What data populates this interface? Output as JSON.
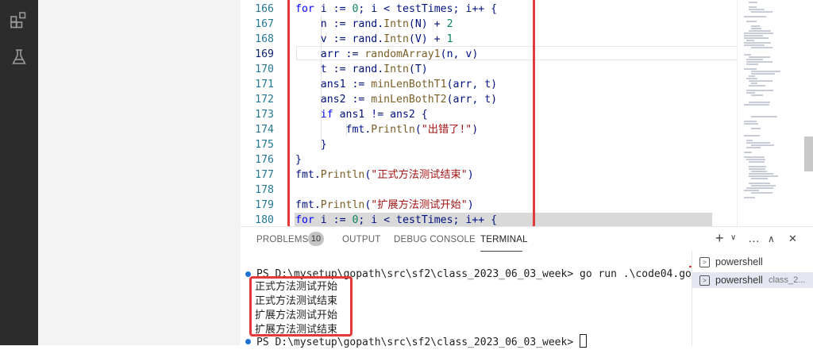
{
  "colors": {
    "accent_red": "#e23a3a",
    "activity_bar": "#2c2c2c",
    "keyword": "#0000ff",
    "number": "#098658",
    "string": "#a31515"
  },
  "activity_bar": {
    "icons": [
      "extensions-icon",
      "testing-flask-icon"
    ]
  },
  "editor": {
    "lines": [
      {
        "num": "166",
        "tokens": [
          {
            "t": "for",
            "c": "kw"
          },
          {
            "t": " i := ",
            "c": "var"
          },
          {
            "t": "0",
            "c": "num"
          },
          {
            "t": "; i < testTimes; i++ {",
            "c": "var"
          }
        ]
      },
      {
        "num": "167",
        "tokens": [
          {
            "t": "    n := rand.",
            "c": "var"
          },
          {
            "t": "Intn",
            "c": "fn"
          },
          {
            "t": "(N) + ",
            "c": "var"
          },
          {
            "t": "2",
            "c": "num"
          }
        ]
      },
      {
        "num": "168",
        "tokens": [
          {
            "t": "    v := rand.",
            "c": "var"
          },
          {
            "t": "Intn",
            "c": "fn"
          },
          {
            "t": "(V) + ",
            "c": "var"
          },
          {
            "t": "1",
            "c": "num"
          }
        ]
      },
      {
        "num": "169",
        "tokens": [
          {
            "t": "    arr := ",
            "c": "var"
          },
          {
            "t": "randomArray1",
            "c": "fn"
          },
          {
            "t": "(n, v)",
            "c": "var"
          }
        ]
      },
      {
        "num": "170",
        "tokens": [
          {
            "t": "    t := rand.",
            "c": "var"
          },
          {
            "t": "Intn",
            "c": "fn"
          },
          {
            "t": "(T)",
            "c": "var"
          }
        ]
      },
      {
        "num": "171",
        "tokens": [
          {
            "t": "    ans1 := ",
            "c": "var"
          },
          {
            "t": "minLenBothT1",
            "c": "fn"
          },
          {
            "t": "(arr, t)",
            "c": "var"
          }
        ]
      },
      {
        "num": "172",
        "tokens": [
          {
            "t": "    ans2 := ",
            "c": "var"
          },
          {
            "t": "minLenBothT2",
            "c": "fn"
          },
          {
            "t": "(arr, t)",
            "c": "var"
          }
        ]
      },
      {
        "num": "173",
        "tokens": [
          {
            "t": "    ",
            "c": "var"
          },
          {
            "t": "if",
            "c": "kw"
          },
          {
            "t": " ans1 != ans2 {",
            "c": "var"
          }
        ]
      },
      {
        "num": "174",
        "tokens": [
          {
            "t": "        fmt.",
            "c": "var"
          },
          {
            "t": "Println",
            "c": "fn"
          },
          {
            "t": "(",
            "c": "var"
          },
          {
            "t": "\"出错了!\"",
            "c": "str"
          },
          {
            "t": ")",
            "c": "var"
          }
        ]
      },
      {
        "num": "175",
        "tokens": [
          {
            "t": "    }",
            "c": "var"
          }
        ]
      },
      {
        "num": "176",
        "tokens": [
          {
            "t": "}",
            "c": "var"
          }
        ]
      },
      {
        "num": "177",
        "tokens": [
          {
            "t": "fmt.",
            "c": "var"
          },
          {
            "t": "Println",
            "c": "fn"
          },
          {
            "t": "(",
            "c": "var"
          },
          {
            "t": "\"正式方法测试结束\"",
            "c": "str"
          },
          {
            "t": ")",
            "c": "var"
          }
        ]
      },
      {
        "num": "178",
        "tokens": []
      },
      {
        "num": "179",
        "tokens": [
          {
            "t": "fmt.",
            "c": "var"
          },
          {
            "t": "Println",
            "c": "fn"
          },
          {
            "t": "(",
            "c": "var"
          },
          {
            "t": "\"扩展方法测试开始\"",
            "c": "str"
          },
          {
            "t": ")",
            "c": "var"
          }
        ]
      },
      {
        "num": "180",
        "tokens": [
          {
            "t": "for",
            "c": "kw"
          },
          {
            "t": " i := ",
            "c": "var"
          },
          {
            "t": "0",
            "c": "num"
          },
          {
            "t": "; i < testTimes; i++ {",
            "c": "var"
          }
        ]
      }
    ]
  },
  "panel": {
    "tabs": [
      "PROBLEMS",
      "OUTPUT",
      "DEBUG CONSOLE",
      "TERMINAL"
    ],
    "problems_count": "10",
    "actions": [
      "+",
      "∨",
      "…",
      "∧",
      "✕"
    ],
    "terminal": {
      "command_line": "PS D:\\mysetup\\gopath\\src\\sf2\\class_2023_06_03_week> go run .\\code04.go",
      "output": [
        "正式方法测试开始",
        "正式方法测试结束",
        "扩展方法测试开始",
        "扩展方法测试结束"
      ],
      "prompt_line": "PS D:\\mysetup\\gopath\\src\\sf2\\class_2023_06_03_week> "
    },
    "terminal_list": [
      {
        "label": "powershell",
        "sub": ""
      },
      {
        "label": "powershell",
        "sub": "class_2..."
      }
    ]
  }
}
